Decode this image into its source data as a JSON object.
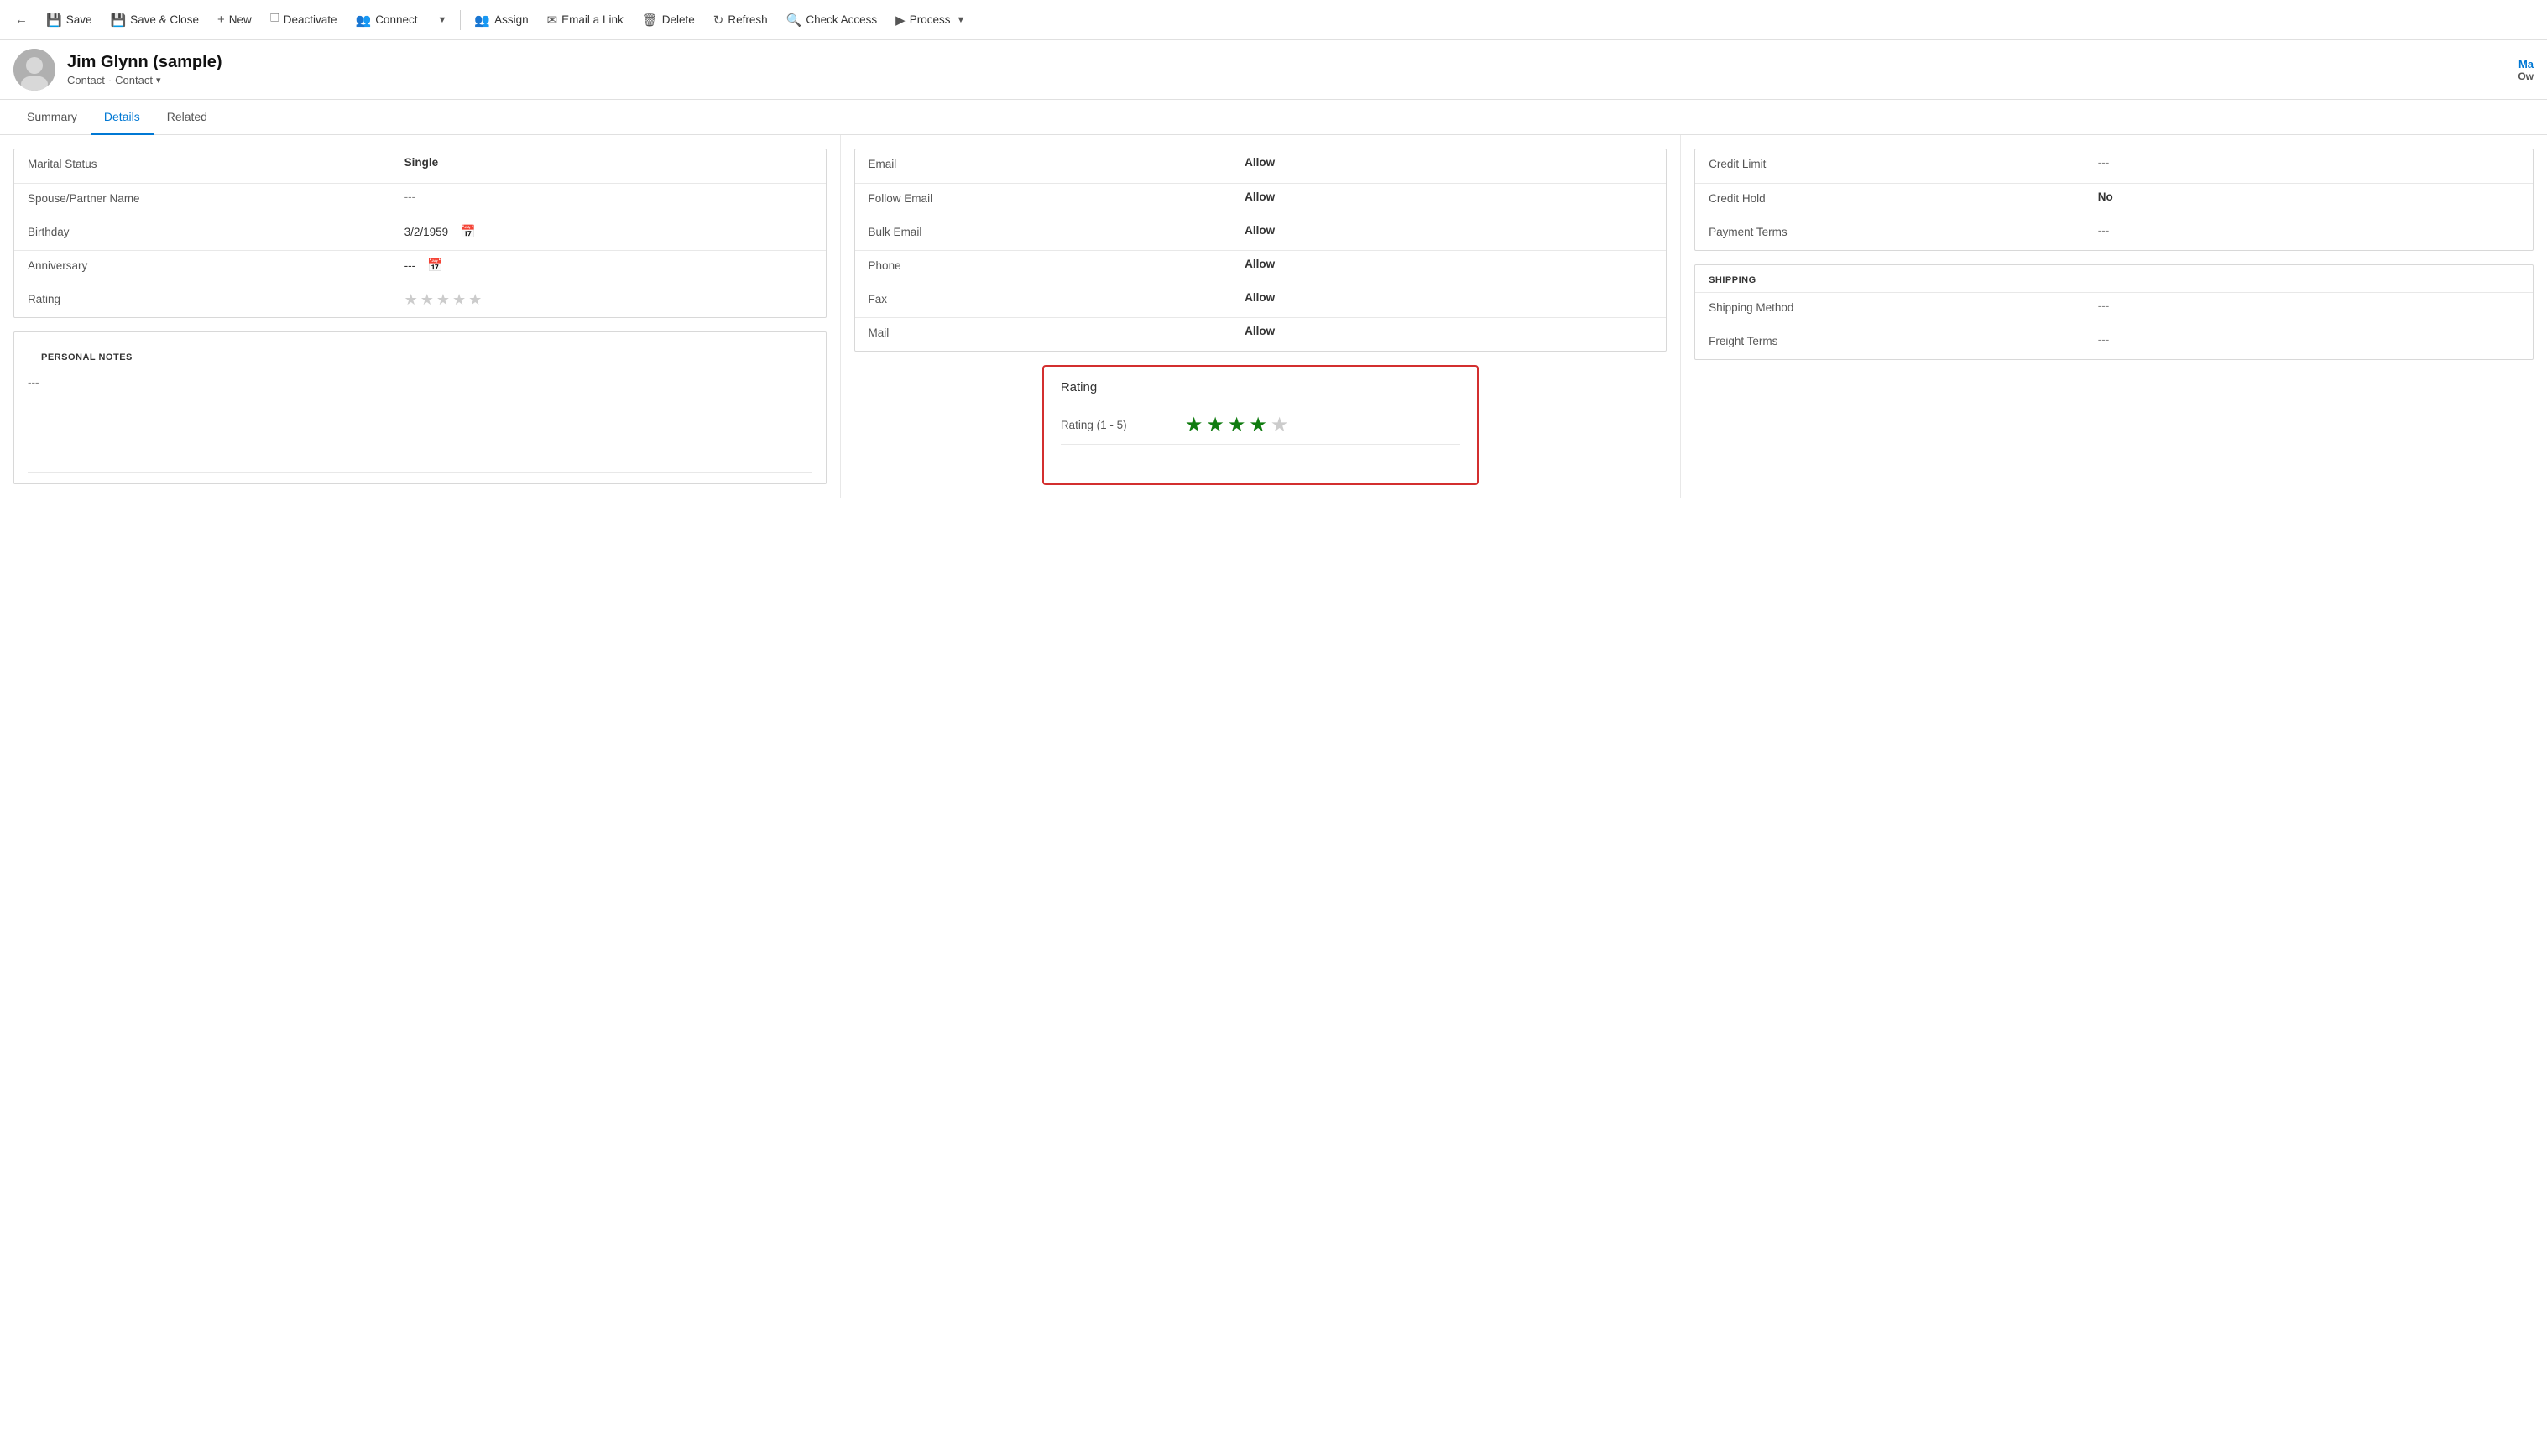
{
  "toolbar": {
    "back_icon": "←",
    "save_label": "Save",
    "save_close_label": "Save & Close",
    "new_label": "New",
    "deactivate_label": "Deactivate",
    "connect_label": "Connect",
    "chevron_label": "▾",
    "assign_label": "Assign",
    "email_link_label": "Email a Link",
    "delete_label": "Delete",
    "refresh_label": "Refresh",
    "check_access_label": "Check Access",
    "process_label": "Process",
    "process_chevron": "▾"
  },
  "header": {
    "name": "Jim Glynn (sample)",
    "breadcrumb1": "Contact",
    "breadcrumb_sep": "·",
    "breadcrumb2": "Contact",
    "breadcrumb_chevron": "▾",
    "ma_label": "Ma",
    "ow_label": "Ow"
  },
  "tabs": [
    {
      "label": "Summary",
      "active": false
    },
    {
      "label": "Details",
      "active": true
    },
    {
      "label": "Related",
      "active": false
    }
  ],
  "personal_info": {
    "section_fields": [
      {
        "label": "Marital Status",
        "value": "Single",
        "type": "text"
      },
      {
        "label": "Spouse/Partner Name",
        "value": "---",
        "type": "muted"
      },
      {
        "label": "Birthday",
        "value": "3/2/1959",
        "type": "date"
      },
      {
        "label": "Anniversary",
        "value": "---",
        "type": "date_muted"
      },
      {
        "label": "Rating",
        "value": "",
        "type": "stars_empty"
      }
    ]
  },
  "personal_notes": {
    "title": "PERSONAL NOTES",
    "value": "---"
  },
  "contact_methods": {
    "fields": [
      {
        "label": "Email",
        "value": "Allow"
      },
      {
        "label": "Follow Email",
        "value": "Allow"
      },
      {
        "label": "Bulk Email",
        "value": "Allow"
      },
      {
        "label": "Phone",
        "value": "Allow"
      },
      {
        "label": "Fax",
        "value": "Allow"
      },
      {
        "label": "Mail",
        "value": "Allow"
      }
    ]
  },
  "rating_popup": {
    "title": "Rating",
    "row_label": "Rating (1 - 5)",
    "filled_stars": 4,
    "total_stars": 5
  },
  "billing": {
    "fields": [
      {
        "label": "Credit Limit",
        "value": "---"
      },
      {
        "label": "Credit Hold",
        "value": "No"
      },
      {
        "label": "Payment Terms",
        "value": "---"
      }
    ]
  },
  "shipping": {
    "title": "SHIPPING",
    "fields": [
      {
        "label": "Shipping Method",
        "value": "---"
      },
      {
        "label": "Freight Terms",
        "value": "---"
      }
    ]
  },
  "colors": {
    "blue": "#0078d4",
    "green": "#107c10",
    "red_border": "#d32f2f"
  }
}
